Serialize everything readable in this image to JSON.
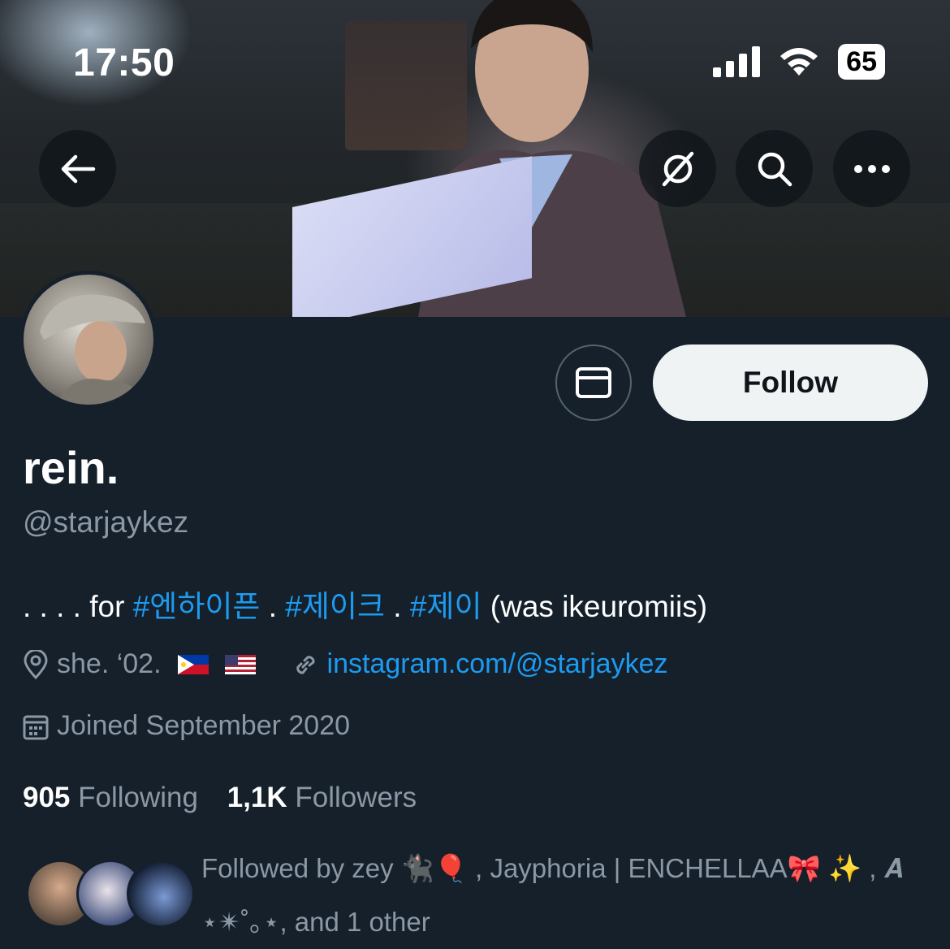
{
  "status_bar": {
    "time": "17:50",
    "battery": "65"
  },
  "header": {
    "back_icon": "arrow-left-icon",
    "grok_icon": "grok-icon",
    "search_icon": "search-icon",
    "more_icon": "more-horizontal-icon"
  },
  "profile": {
    "name": "rein.",
    "handle": "@starjaykez",
    "bio": {
      "prefix": ". . . . for ",
      "tag1": "#엔하이픈",
      "sep1": " . ",
      "tag2": "#제이크",
      "sep2": " . ",
      "tag3": "#제이",
      "suffix": " (was ikeuromiis)"
    },
    "location": "she. ‘02.",
    "website": "instagram.com/@starjaykez",
    "joined": "Joined September 2020",
    "following_count": "905",
    "following_label": "Following",
    "followers_count": "1,1K",
    "followers_label": "Followers",
    "followed_by": "Followed by zey 🐈‍⬛🎈 , Jayphoria | ENCHELLAA🎀 ✨ , 𝑨 ⋆✴︎˚｡⋆, and 1 other"
  },
  "actions": {
    "follow_label": "Follow",
    "dm_icon": "envelope-icon"
  },
  "colors": {
    "background": "#15202b",
    "accent": "#1d9bf0",
    "muted": "#8b98a5",
    "follow_bg": "#eff3f4"
  }
}
